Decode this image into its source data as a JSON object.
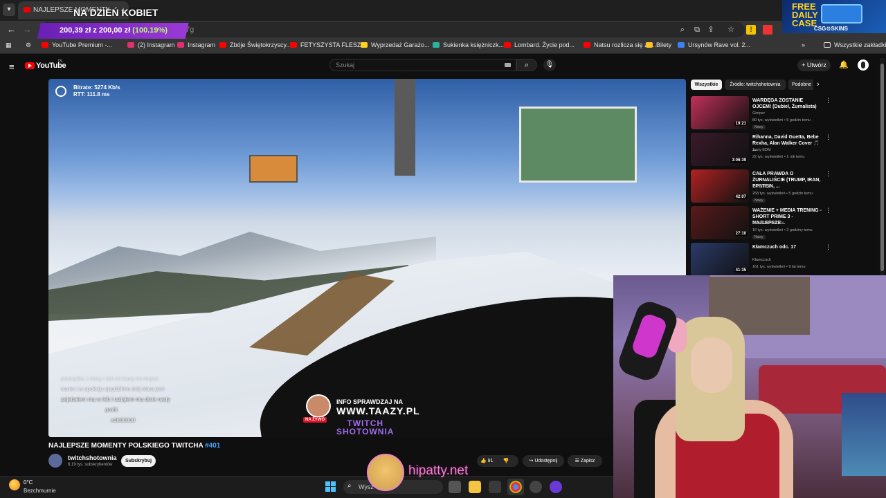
{
  "browser": {
    "active_tab_title": "NAJLEPSZE MOMENTY PO",
    "overlay_title": "NA DZIEŃ KOBIET",
    "donation": {
      "text": "200,39 zł z 200,00 zł",
      "percent": "(100.19%)"
    },
    "omnibox_partial": "7g",
    "bookmarks": [
      {
        "label": "YouTube Premium -...",
        "color": "#ff0000"
      },
      {
        "label": "(2) Instagram",
        "color": "#e1306c"
      },
      {
        "label": "Instagram",
        "color": "#e1306c"
      },
      {
        "label": "Zbóje Świętokrzyscy...",
        "color": "#ff0000"
      },
      {
        "label": "FETYSZYSTA FLESZ...",
        "color": "#ff0000"
      },
      {
        "label": "Wyprzedaż Garażo...",
        "color": "#ffd21f"
      },
      {
        "label": "Sukienka księżniczk...",
        "color": "#2bb5a0"
      },
      {
        "label": "Lombard. Życie pod...",
        "color": "#ff0000"
      },
      {
        "label": "Natsu rozlicza się ze...",
        "color": "#ff0000"
      },
      {
        "label": "Bilety",
        "color": "#ffc02a"
      },
      {
        "label": "Ursynów Rave vol. 2...",
        "color": "#3b82f6"
      }
    ],
    "all_bookmarks": "Wszystkie zakładki"
  },
  "ad": {
    "line1": "FREE",
    "line2": "DAILY",
    "line3": "CASE",
    "brand": "CSG⚙SKINS"
  },
  "youtube": {
    "logo_text": "YouTube",
    "logo_country": "PL",
    "search_placeholder": "Szukaj",
    "create_label": "+ Utwórz"
  },
  "video": {
    "bitrate": "Bitrate: 5274 Kb/s",
    "rtt": "RTT: 111.8 ms",
    "chat": [
      {
        "user": "",
        "text": "pieniądze z kasy i dał mi kasę na mięso"
      },
      {
        "user": "",
        "text": "nanie i w spokoju spędziłem mój stara jest"
      },
      {
        "user": "",
        "text": "zajebałem mu w leb i wziąłem mu dwie narty"
      },
      {
        "user": "",
        "text": "profit"
      },
      {
        "user": "",
        "text": "xddddddd"
      }
    ],
    "live_badge": "NA ŻYWO",
    "info_line": "INFO SPRAWDZAJ NA",
    "info_site": "WWW.TAAZY.PL",
    "info_twitch_1": "TWITCH",
    "info_twitch_2": "SHOTOWNIA",
    "title": "NAJLEPSZE MOMENTY POLSKIEGO TWITCHA ",
    "title_num": "#401",
    "channel_name": "twitchshotownia",
    "channel_subs": "8,19 tys. subskrybentów",
    "subscribe": "Subskrybuj",
    "likes": "91",
    "share": "Udostępnij",
    "save": "Zapisz"
  },
  "sidebar": {
    "filters": [
      "Wszystkie",
      "Źródło: twitchshotownia",
      "Podobne"
    ],
    "recs": [
      {
        "title": "WARDĘGA ZOSTANIE OJCEM! (Dubiel, Żurnalista)",
        "channel": "Gimper",
        "meta": "80 tys. wyświetleń • 5 godzin temu",
        "new": "Nowy",
        "duration": "19:21",
        "thumb": "#c0305a"
      },
      {
        "title": "Rihanna, David Guetta, Bebe Rexha, Alan Walker Cover 🎵 ...",
        "channel": "Tasty EDM",
        "meta": "22 tys. wyświetleń • 1 rok temu",
        "new": "",
        "duration": "3:06:39",
        "thumb": "#3a1a2a"
      },
      {
        "title": "CAŁA PRAWDA O ŻURNALIŚCIE (TRUMP, IRAN, EPSTEIN, ...",
        "channel": "Konopskyy",
        "meta": "268 tys. wyświetleń • 5 godzin temu",
        "new": "Nowy",
        "duration": "42:07",
        "thumb": "#b02222"
      },
      {
        "title": "WAŻENIE + MEDIA TRENING - SHORT PRIME 3 - NAJLEPSZE...",
        "channel": "WYBITNE SHOTY",
        "meta": "16 tys. wyświetleń • 2 godziny temu",
        "new": "Nowy",
        "duration": "27:10",
        "thumb": "#5a1a1a"
      },
      {
        "title": "Kłamczuch odc. 17",
        "channel": "Kłamczuch",
        "meta": "161 tys. wyświetleń • 9 lat temu",
        "new": "",
        "duration": "41:35",
        "thumb": "#2a3a6a"
      }
    ]
  },
  "taskbar": {
    "temp": "0°C",
    "weather": "Bezchmurnie",
    "search": "Wysz"
  },
  "overlay": {
    "watermark": "hipatty.net"
  }
}
